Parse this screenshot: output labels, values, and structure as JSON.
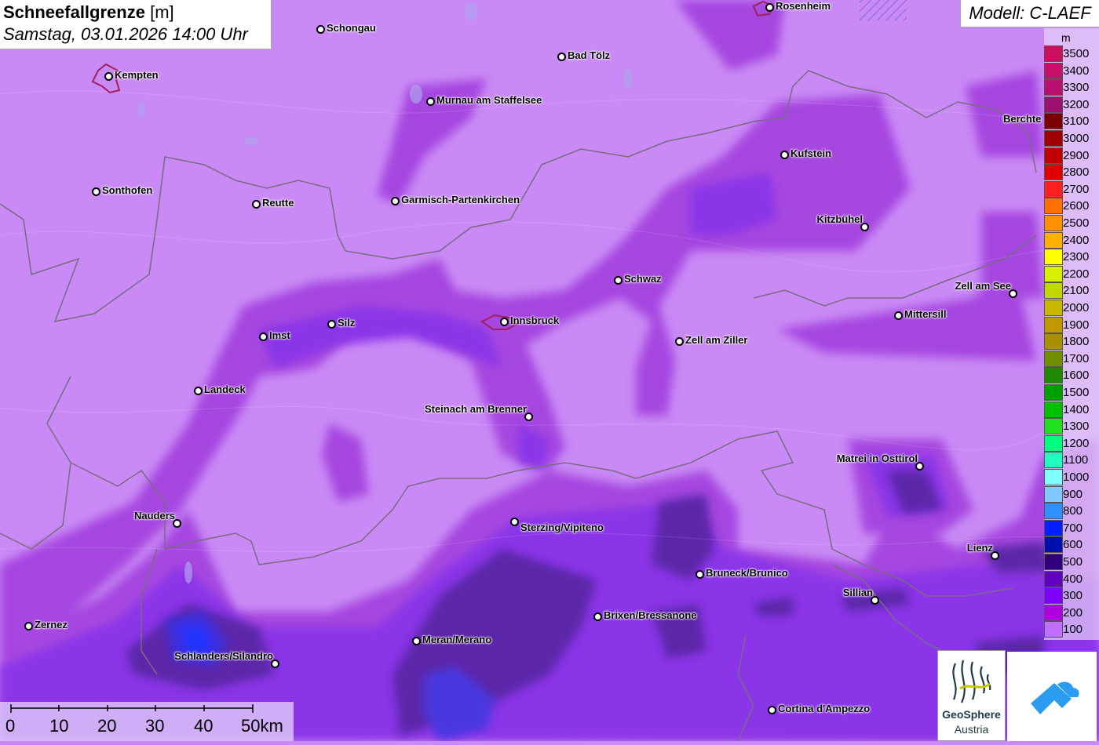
{
  "header": {
    "title": "Schneefallgrenze",
    "unit": "[m]",
    "subtitle": "Samstag, 03.01.2026 14:00 Uhr",
    "model": "Modell: C-LAEF"
  },
  "legend": {
    "unit": "m",
    "items": [
      {
        "label": "3500",
        "color": "#cc1060"
      },
      {
        "label": "3400",
        "color": "#c8106a"
      },
      {
        "label": "3300",
        "color": "#b81070"
      },
      {
        "label": "3200",
        "color": "#9e1070"
      },
      {
        "label": "3100",
        "color": "#7a0000"
      },
      {
        "label": "3000",
        "color": "#a00000"
      },
      {
        "label": "2900",
        "color": "#c00000"
      },
      {
        "label": "2800",
        "color": "#e00000"
      },
      {
        "label": "2700",
        "color": "#ff2020"
      },
      {
        "label": "2600",
        "color": "#ff7000"
      },
      {
        "label": "2500",
        "color": "#ff9000"
      },
      {
        "label": "2400",
        "color": "#ffb000"
      },
      {
        "label": "2300",
        "color": "#ffff00"
      },
      {
        "label": "2200",
        "color": "#d8f000"
      },
      {
        "label": "2100",
        "color": "#c0d800"
      },
      {
        "label": "2000",
        "color": "#c8b800"
      },
      {
        "label": "1900",
        "color": "#c09800"
      },
      {
        "label": "1800",
        "color": "#a89000"
      },
      {
        "label": "1700",
        "color": "#709000"
      },
      {
        "label": "1600",
        "color": "#208800"
      },
      {
        "label": "1500",
        "color": "#00a000"
      },
      {
        "label": "1400",
        "color": "#00c000"
      },
      {
        "label": "1300",
        "color": "#20e020"
      },
      {
        "label": "1200",
        "color": "#00ff80"
      },
      {
        "label": "1100",
        "color": "#20ffc0"
      },
      {
        "label": "1000",
        "color": "#80ffff"
      },
      {
        "label": "900",
        "color": "#80c8ff"
      },
      {
        "label": "800",
        "color": "#3090ff"
      },
      {
        "label": "700",
        "color": "#0020ff"
      },
      {
        "label": "600",
        "color": "#0010b0"
      },
      {
        "label": "500",
        "color": "#300080"
      },
      {
        "label": "400",
        "color": "#6000c0"
      },
      {
        "label": "300",
        "color": "#8000ff"
      },
      {
        "label": "200",
        "color": "#b000e0"
      },
      {
        "label": "100",
        "color": "#c070ff"
      }
    ]
  },
  "cities": [
    {
      "name": "Rosenheim"
    },
    {
      "name": "Schongau"
    },
    {
      "name": "Kempten"
    },
    {
      "name": "Bad Tölz"
    },
    {
      "name": "Murnau am Staffelsee"
    },
    {
      "name": "Berchte"
    },
    {
      "name": "Kufstein"
    },
    {
      "name": "Sonthofen"
    },
    {
      "name": "Reutte"
    },
    {
      "name": "Garmisch-Partenkirchen"
    },
    {
      "name": "Kitzbühel"
    },
    {
      "name": "Schwaz"
    },
    {
      "name": "Zell am See"
    },
    {
      "name": "Mittersill"
    },
    {
      "name": "Imst"
    },
    {
      "name": "Silz"
    },
    {
      "name": "Innsbruck"
    },
    {
      "name": "Zell am Ziller"
    },
    {
      "name": "Landeck"
    },
    {
      "name": "Steinach am Brenner"
    },
    {
      "name": "Matrei in Osttirol"
    },
    {
      "name": "Nauders"
    },
    {
      "name": "Sterzing/Vipiteno"
    },
    {
      "name": "Lienz"
    },
    {
      "name": "Bruneck/Brunico"
    },
    {
      "name": "Sillian"
    },
    {
      "name": "Brixen/Bressanone"
    },
    {
      "name": "Zernez"
    },
    {
      "name": "Meran/Merano"
    },
    {
      "name": "Schlanders/Silandro"
    },
    {
      "name": "Cortina d'Ampezzo"
    }
  ],
  "scale": {
    "labels": [
      "0",
      "10",
      "20",
      "30",
      "40",
      "50km"
    ]
  },
  "logos": {
    "geosphere_line1": "GeoSphere",
    "geosphere_line2": "Austria"
  }
}
